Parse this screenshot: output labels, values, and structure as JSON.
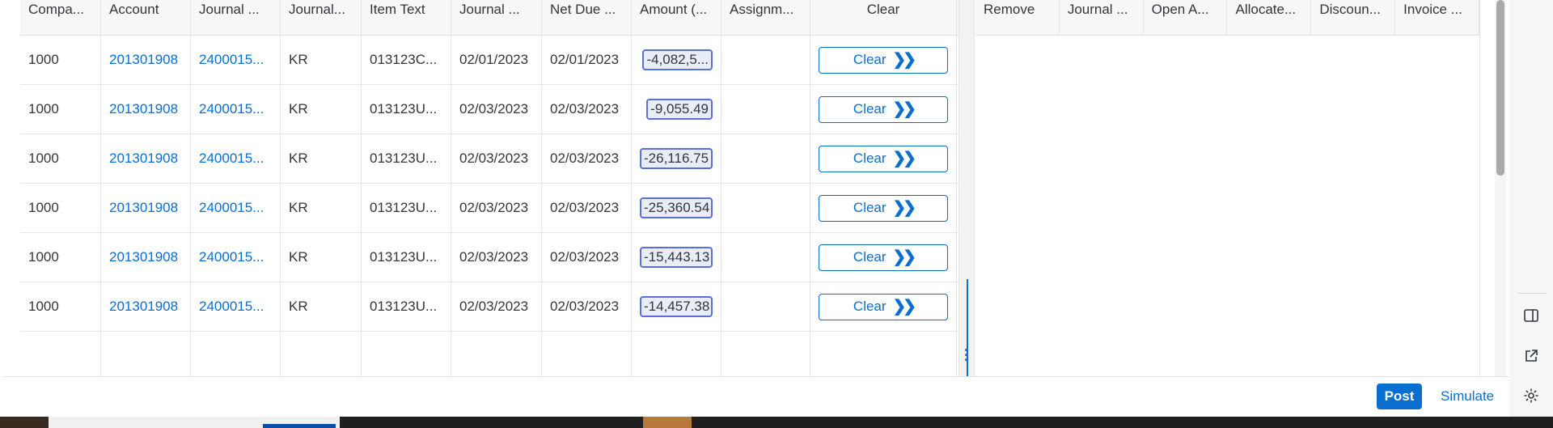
{
  "left_table": {
    "columns": [
      "Compa...",
      "Account",
      "Journal ...",
      "Journal...",
      "Item Text",
      "Journal ...",
      "Net Due ...",
      "Amount (...",
      "Assignm...",
      "Clear"
    ],
    "rows": [
      {
        "company": "1000",
        "account": "201301908",
        "journal": "2400015...",
        "journal_type": "KR",
        "item_text": "013123C...",
        "journal_date": "02/01/2023",
        "net_due": "02/01/2023",
        "amount": "-4,082,5...",
        "assignment": "",
        "clear_label": "Clear"
      },
      {
        "company": "1000",
        "account": "201301908",
        "journal": "2400015...",
        "journal_type": "KR",
        "item_text": "013123U...",
        "journal_date": "02/03/2023",
        "net_due": "02/03/2023",
        "amount": "-9,055.49",
        "assignment": "",
        "clear_label": "Clear"
      },
      {
        "company": "1000",
        "account": "201301908",
        "journal": "2400015...",
        "journal_type": "KR",
        "item_text": "013123U...",
        "journal_date": "02/03/2023",
        "net_due": "02/03/2023",
        "amount": "-26,116.75",
        "assignment": "",
        "clear_label": "Clear"
      },
      {
        "company": "1000",
        "account": "201301908",
        "journal": "2400015...",
        "journal_type": "KR",
        "item_text": "013123U...",
        "journal_date": "02/03/2023",
        "net_due": "02/03/2023",
        "amount": "-25,360.54",
        "assignment": "",
        "clear_label": "Clear"
      },
      {
        "company": "1000",
        "account": "201301908",
        "journal": "2400015...",
        "journal_type": "KR",
        "item_text": "013123U...",
        "journal_date": "02/03/2023",
        "net_due": "02/03/2023",
        "amount": "-15,443.13",
        "assignment": "",
        "clear_label": "Clear"
      },
      {
        "company": "1000",
        "account": "201301908",
        "journal": "2400015...",
        "journal_type": "KR",
        "item_text": "013123U...",
        "journal_date": "02/03/2023",
        "net_due": "02/03/2023",
        "amount": "-14,457.38",
        "assignment": "",
        "clear_label": "Clear"
      }
    ]
  },
  "right_table": {
    "columns": [
      "Remove",
      "Journal ...",
      "Open A...",
      "Allocate...",
      "Discoun...",
      "Invoice ..."
    ]
  },
  "footer": {
    "post_label": "Post",
    "simulate_label": "Simulate"
  },
  "icons": {
    "clear_chevron": "double-chevron-right-icon",
    "side_panel": "side-panel-icon",
    "open_external": "open-external-icon",
    "settings": "gear-icon"
  },
  "colors": {
    "accent": "#0a6ed1",
    "amount_highlight_border": "#5b6fd8",
    "amount_highlight_bg": "#e9edf8"
  }
}
